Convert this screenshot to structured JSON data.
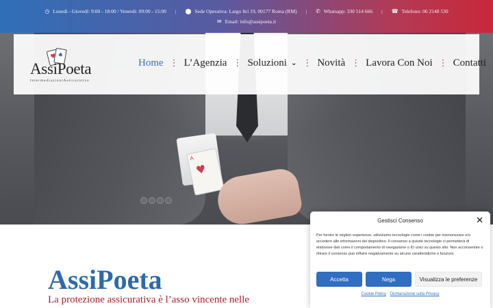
{
  "topbar": {
    "hours": "Lunedì - Giovedì: 9:00 - 18:00 / Venerdì: 09:00 - 15:00",
    "address": "Sede Operativa: Largo Itri 19, 00177 Roma (RM)",
    "whatsapp": "Whatsapp: 330 514 666",
    "phone": "Telefono: 06 2148 530",
    "email": "Email: info@assipoeta.it",
    "separator": "|"
  },
  "logo": {
    "name": "AssiPoeta",
    "tagline": "IntermediazioniAssicurative"
  },
  "nav": {
    "items": [
      {
        "label": "Home"
      },
      {
        "label": "L’Agenzia"
      },
      {
        "label": "Soluzioni"
      },
      {
        "label": "Novità"
      },
      {
        "label": "Lavora Con Noi"
      },
      {
        "label": "Contatti"
      }
    ],
    "separator": "⋮",
    "active_color": "#3c6fb3"
  },
  "content": {
    "title": "AssiPoeta",
    "subtitle": "La protezione assicurativa è l’asso vincente nelle"
  },
  "cookie": {
    "title": "Gestisci Consenso",
    "body": "Per fornire le migliori esperienze, utilizziamo tecnologie come i cookie per memorizzare e/o accedere alle informazioni del dispositivo. Il consenso a queste tecnologie ci permetterà di elaborare dati come il comportamento di navigazione o ID unici su questo sito. Non acconsentire o ritirare il consenso può influire negativamente su alcune caratteristiche e funzioni.",
    "accept": "Accetta",
    "deny": "Nega",
    "preferences": "Visualizza le preferenze",
    "link_cookie": "Cookie Policy",
    "link_privacy": "Dichiarazione sulla Privacy"
  },
  "colors": {
    "brand_blue": "#2d6aaa",
    "brand_red": "#a6232f",
    "button_blue": "#2f6ec0"
  }
}
